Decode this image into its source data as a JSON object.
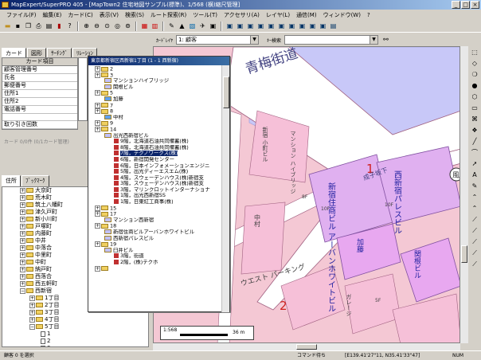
{
  "window": {
    "title": "MapExpert/SuperPRO 405 - [MapTown2 住宅地図サンプル(標準)、1/568 (横)縮尺管理]"
  },
  "menu": [
    "ファイル(F)",
    "編集(E)",
    "カード(C)",
    "表示(V)",
    "検索(S)",
    "ルート探索(R)",
    "ツール(T)",
    "アクセサリ(A)",
    "レイヤ(L)",
    "通信(M)",
    "ウィンドウ(W)",
    "?"
  ],
  "toolbar2": {
    "layer_label": "ｶｰﾄﾞﾚｲﾔ",
    "layer_value": "1: 顧客",
    "search_label": "ｷｰ検索",
    "search_value": ""
  },
  "left_tabs": {
    "card": "カード",
    "figure": "図形",
    "search": "ｻｰﾁﾝｸﾞ",
    "relation": "ﾘﾚｰｼｮﾝ"
  },
  "card_table": {
    "header": "カード項目",
    "rows": [
      "顧客管理番号",
      "氏名",
      "郵便番号",
      "住所1",
      "住所2",
      "電話番号",
      "",
      "取り引き回数"
    ]
  },
  "card_status": "カード 0/0件 (0/1カード管理)",
  "addr_tabs": {
    "address": "住所",
    "bookmark": "ﾌﾞｯｸﾏｰｸ"
  },
  "addr_tree": [
    "大京町",
    "荒木町",
    "筑土八幡町",
    "津久戸町",
    "新小川町",
    "戸塚町",
    "内藤町",
    "中井",
    "中落合",
    "中里町",
    "中町",
    "納戸町",
    "西落合",
    "西五軒町",
    "西新宿",
    "1丁目",
    "2丁目",
    "3丁目",
    "4丁目",
    "5丁目",
    "1",
    "2",
    "3"
  ],
  "popup": {
    "title": "東京都新宿区西新宿1丁目 (1 - 1 西新宿)",
    "items": [
      {
        "t": "2",
        "lv": 0,
        "k": "folder"
      },
      {
        "t": "3",
        "lv": 0,
        "k": "folder"
      },
      {
        "t": "マンションハイブリッジ",
        "lv": 1,
        "k": "bldg"
      },
      {
        "t": "関根ビル",
        "lv": 1,
        "k": "bldg"
      },
      {
        "t": "5",
        "lv": 0,
        "k": "folder"
      },
      {
        "t": "加藤",
        "lv": 1,
        "k": "house"
      },
      {
        "t": "7",
        "lv": 0,
        "k": "folder"
      },
      {
        "t": "8",
        "lv": 0,
        "k": "folder"
      },
      {
        "t": "中村",
        "lv": 1,
        "k": "house"
      },
      {
        "t": "9",
        "lv": 0,
        "k": "folder"
      },
      {
        "t": "14",
        "lv": 0,
        "k": "folder"
      },
      {
        "t": "出光西新宿ビル",
        "lv": 1,
        "k": "bldg"
      },
      {
        "t": "9階，北海道石油共同備蓄(株)",
        "lv": 2,
        "k": "tenant"
      },
      {
        "t": "8階，北海道石油共同備蓄(株)",
        "lv": 2,
        "k": "tenant"
      },
      {
        "t": "7階，テクノワークス(株)",
        "lv": 2,
        "k": "tenant",
        "sel": true
      },
      {
        "t": "6階，新宿開発センター",
        "lv": 2,
        "k": "tenant"
      },
      {
        "t": "6階，日本インフォメーションエンジニ",
        "lv": 2,
        "k": "tenant"
      },
      {
        "t": "5階，出光ディーエスエム(株)",
        "lv": 2,
        "k": "tenant"
      },
      {
        "t": "4階，スウェーデンハウス(株)新宿支",
        "lv": 2,
        "k": "tenant"
      },
      {
        "t": "3階，スウェーデンハウス(株)新宿支",
        "lv": 2,
        "k": "tenant"
      },
      {
        "t": "3階，マリンクロットインターナショナ",
        "lv": 2,
        "k": "tenant"
      },
      {
        "t": "1階，出光西新宿SS",
        "lv": 2,
        "k": "tenant"
      },
      {
        "t": "1階，日東紅工商事(株)",
        "lv": 2,
        "k": "tenant"
      },
      {
        "t": "15",
        "lv": 0,
        "k": "folder"
      },
      {
        "t": "17",
        "lv": 0,
        "k": "folder"
      },
      {
        "t": "マンション西新宿",
        "lv": 1,
        "k": "bldg"
      },
      {
        "t": "18",
        "lv": 0,
        "k": "folder"
      },
      {
        "t": "新宿住商ビルアーバンホワイトビル",
        "lv": 1,
        "k": "bldg"
      },
      {
        "t": "西新宿パレスビル",
        "lv": 1,
        "k": "bldg"
      },
      {
        "t": "19",
        "lv": 0,
        "k": "folder"
      },
      {
        "t": "臼井ビル",
        "lv": 1,
        "k": "bldg"
      },
      {
        "t": "3階，街道",
        "lv": 2,
        "k": "tenant"
      },
      {
        "t": "2階，(株)テクホ",
        "lv": 2,
        "k": "tenant"
      },
      {
        "t": "",
        "lv": 0,
        "k": "folder"
      }
    ]
  },
  "map": {
    "road_label": "青梅街道",
    "street_label": "成子坂下",
    "bldg1_name": "新宿住商ビル アーバンホワイトビル",
    "bldg2_name": "西新宿パレスビル",
    "bldg3_name": "加藤",
    "bldg4_name": "関根ビル",
    "bldg5_name": "中村",
    "bldg6_name": "ウエスト パーキング",
    "bldg7_name": "マンション ハイブリッジ",
    "bldg8_name": "新宿 小町ビル",
    "bldg9_name": "ガレージ",
    "mark1": "1",
    "mark2": "2",
    "mark_fu": "風",
    "scale_text": "1:568",
    "scale_dist": "36 m",
    "floor_labels": [
      "10F",
      "10F",
      "8F",
      "5F"
    ]
  },
  "status": {
    "left": "顧客 0 を選択",
    "command": "コマンド待ち",
    "coords": "[E139.41'27\"11, N35.41'33\"47]",
    "num": "NUM"
  },
  "colors": {
    "titlebar": "#0a246a",
    "map_bg": "#f4c8d4",
    "map_blue": "#c8c8f8",
    "road": "#ffffff",
    "red": "#d02020"
  }
}
